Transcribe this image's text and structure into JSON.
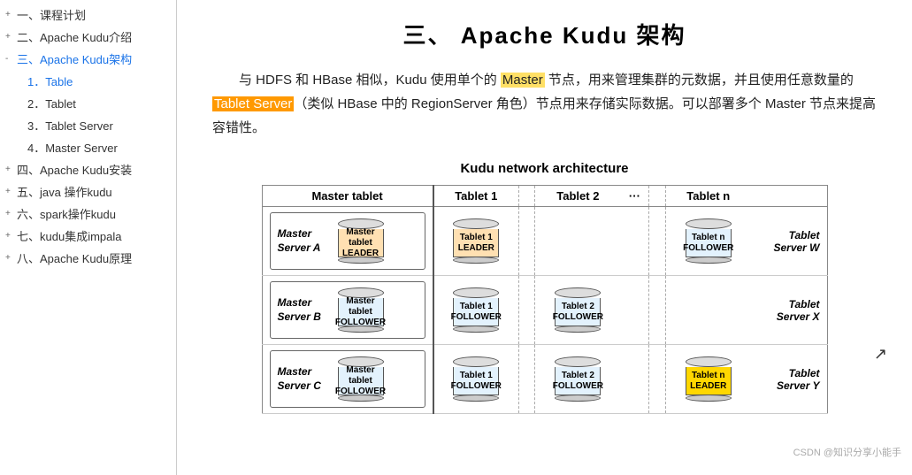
{
  "sidebar": {
    "items": [
      {
        "id": "item-kecheng",
        "label": "一、课程计划",
        "level": 1,
        "expand": "+",
        "active": false
      },
      {
        "id": "item-kudu-intro",
        "label": "二、Apache Kudu介绍",
        "level": 1,
        "expand": "+",
        "active": false
      },
      {
        "id": "item-kudu-arch",
        "label": "三、Apache Kudu架构",
        "level": 1,
        "expand": "-",
        "active": true
      },
      {
        "id": "item-table",
        "label": "1．Table",
        "level": 2,
        "expand": "",
        "active": true
      },
      {
        "id": "item-tablet",
        "label": "2．Tablet",
        "level": 2,
        "expand": "",
        "active": false
      },
      {
        "id": "item-tablet-server",
        "label": "3．Tablet Server",
        "level": 2,
        "expand": "",
        "active": false
      },
      {
        "id": "item-master-server",
        "label": "4．Master Server",
        "level": 2,
        "expand": "",
        "active": false
      },
      {
        "id": "item-kudu-install",
        "label": "四、Apache Kudu安装",
        "level": 1,
        "expand": "+",
        "active": false
      },
      {
        "id": "item-java-kudu",
        "label": "五、java 操作kudu",
        "level": 1,
        "expand": "+",
        "active": false
      },
      {
        "id": "item-spark-kudu",
        "label": "六、spark操作kudu",
        "level": 1,
        "expand": "+",
        "active": false
      },
      {
        "id": "item-kudu-impala",
        "label": "七、kudu集成impala",
        "level": 1,
        "expand": "+",
        "active": false
      },
      {
        "id": "item-kudu-principle",
        "label": "八、Apache Kudu原理",
        "level": 1,
        "expand": "+",
        "active": false
      }
    ]
  },
  "main": {
    "title": "三、    Apache Kudu 架构",
    "para1_parts": [
      {
        "text": "与 HDFS 和 HBase 相似，Kudu 使用单个的 ",
        "type": "normal"
      },
      {
        "text": "Master",
        "type": "highlight-yellow"
      },
      {
        "text": " 节点，用来管理集群的元\n数据，并且使用任意数量的 ",
        "type": "normal"
      },
      {
        "text": "Tablet Server",
        "type": "highlight-orange"
      },
      {
        "text": "（类似 HBase 中的 RegionServer 角\n色）节点用来存储实际数据。可以部署多个 Master 节点来提高容错性。",
        "type": "normal"
      }
    ],
    "diagram": {
      "title": "Kudu network architecture",
      "header": {
        "master_col": "Master tablet",
        "tablet1": "Tablet 1",
        "tablet2": "Tablet 2",
        "dots": "···",
        "tabletn": "Tablet n"
      },
      "rows": [
        {
          "master_label": "Master\nServer A",
          "master_tablet_label": "Master tablet\nLEADER",
          "master_type": "leader",
          "t1_label": "Tablet 1\nLEADER",
          "t1_type": "leader",
          "t2_label": "",
          "t2_type": "empty",
          "tn_label": "Tablet n\nFOLLOWER",
          "tn_type": "follower",
          "server_label": "Tablet\nServer W"
        },
        {
          "master_label": "Master\nServer B",
          "master_tablet_label": "Master tablet\nFOLLOWER",
          "master_type": "follower",
          "t1_label": "Tablet 1\nFOLLOWER",
          "t1_type": "follower",
          "t2_label": "Tablet 2\nFOLLOWER",
          "t2_type": "follower",
          "tn_label": "",
          "tn_type": "empty",
          "server_label": "Tablet\nServer X"
        },
        {
          "master_label": "Master\nServer C",
          "master_tablet_label": "Master tablet\nFOLLOWER",
          "master_type": "follower",
          "t1_label": "Tablet 1\nFOLLOWER",
          "t1_type": "follower",
          "t2_label": "Tablet 2\nFOLLOWER",
          "t2_type": "follower",
          "tn_label": "Tablet n\nLEADER",
          "tn_type": "leader-gold",
          "server_label": "Tablet\nServer Y"
        }
      ]
    }
  },
  "watermark": "CSDN @知识分享小能手"
}
